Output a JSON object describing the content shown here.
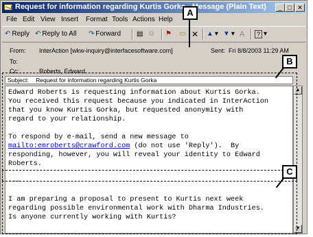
{
  "window": {
    "title": "Request for information regarding Kurtis Gorka - Message (Plain Text)",
    "controls": [
      "_",
      "□",
      "✕"
    ]
  },
  "menu": [
    "File",
    "Edit",
    "View",
    "Insert",
    "Format",
    "Tools",
    "Actions",
    "Help"
  ],
  "toolbar": {
    "reply": "Reply",
    "reply_all": "Reply to All",
    "forward": "Forward"
  },
  "header": {
    "from_label": "From:",
    "from_value": "InterAction [wkw-inquiry@interfacesoftware.com]",
    "sent_label": "Sent:",
    "sent_value": "Fri 8/8/2003 11:29 AM",
    "to_label": "To:",
    "to_value": "",
    "cc_label": "Cc:",
    "cc_value": "Roberts, Edward",
    "subject_label": "Subject:",
    "subject_value": "Request for information regarding Kurtis Gorka"
  },
  "body": {
    "para1": [
      "Edward Roberts is requesting information about Kurtis Gorka.",
      "You received this request because you indicated in InterAction",
      "that you know Kurtis Gorka, but requested anonymity with",
      "regard to your relationship."
    ],
    "para2_line1": "To respond by e-mail, send a new message to",
    "para2_link": "mailto:emroberts@crawford.com",
    "para2_line2_rest": " (do not use 'Reply').  By",
    "para2_line3": "responding, however, you will reveal your identity to Edward",
    "para2_line4": "Roberts.",
    "separator": "---",
    "para3": [
      "I am preparing a proposal to present to Kurtis next week",
      "regarding possible environmental work with Dharma Industries.",
      "Is anyone currently working with Kurtis?"
    ]
  },
  "callouts": {
    "a": "A",
    "b": "B",
    "c": "C"
  }
}
